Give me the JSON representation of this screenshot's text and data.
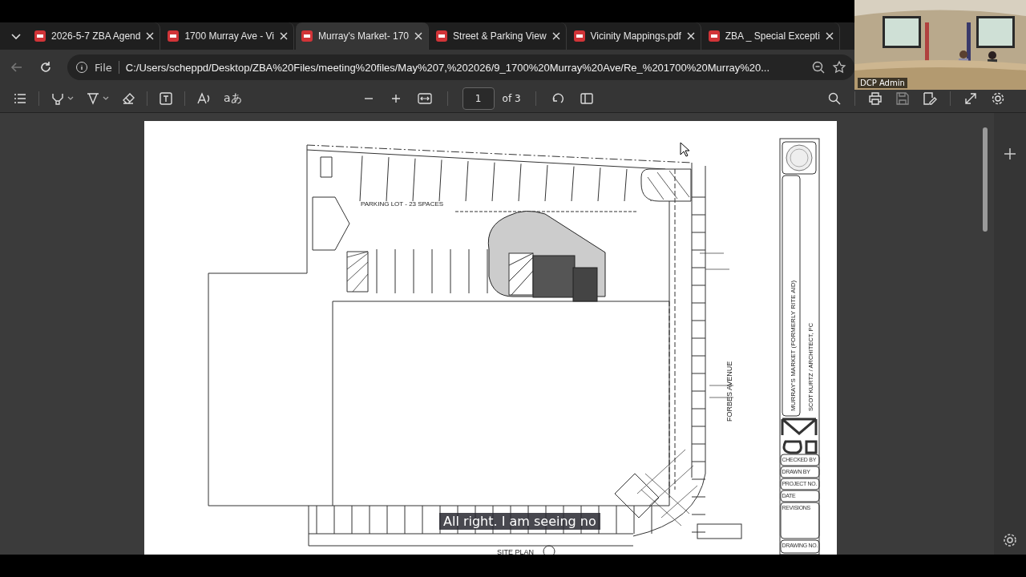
{
  "tabs": [
    {
      "title": "2026-5-7 ZBA Agend",
      "selected": false
    },
    {
      "title": "1700 Murray Ave - Vi",
      "selected": false
    },
    {
      "title": "Murray's Market- 170",
      "selected": true
    },
    {
      "title": "Street & Parking View",
      "selected": false
    },
    {
      "title": "Vicinity Mappings.pdf",
      "selected": false
    },
    {
      "title": "ZBA _ Special Excepti",
      "selected": false
    }
  ],
  "address_bar": {
    "scheme_label": "File",
    "url": "C:/Users/scheppd/Desktop/ZBA%20Files/meeting%20files/May%207,%202026/9_1700%20Murray%20Ave/Re_%201700%20Murray%20..."
  },
  "pdf_toolbar": {
    "translate_glyph": "aあ",
    "page": "1",
    "page_count": "of 3"
  },
  "document": {
    "parking_label": "PARKING LOT - 23 SPACES",
    "street_label": "FORBES AVENUE",
    "plan_title": "SITE PLAN",
    "title_block": {
      "project": "MURRAY'S MARKET (FORMERLY RITE AID)",
      "architect": "SCOT KURTZ / ARCHITECT, PC",
      "fields": [
        "CHECKED BY",
        "DRAWN BY",
        "PROJECT NO.",
        "DATE",
        "REVISIONS",
        "DRAWING NO."
      ]
    }
  },
  "participant": {
    "name": "DCP Admin"
  },
  "caption": "All right. I am seeing no"
}
